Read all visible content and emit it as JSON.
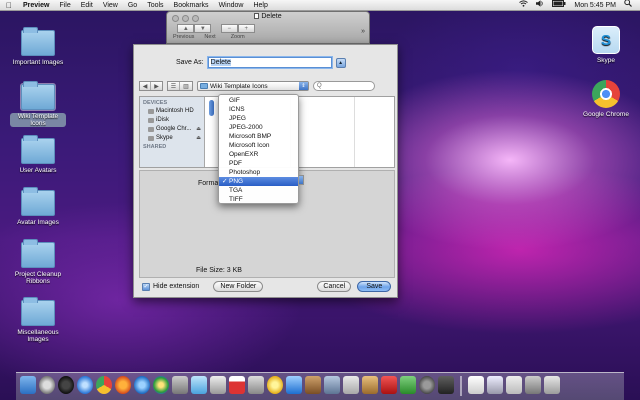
{
  "menubar": {
    "apple_glyph": "",
    "app_name": "Preview",
    "items": [
      "File",
      "Edit",
      "View",
      "Go",
      "Tools",
      "Bookmarks",
      "Window",
      "Help"
    ],
    "clock": "Mon 5:45 PM"
  },
  "desktop": {
    "left_icons": [
      {
        "label": "Important Images"
      },
      {
        "label": "Wiki Template Icons",
        "selected": true
      },
      {
        "label": "User Avatars"
      },
      {
        "label": "Avatar Images"
      },
      {
        "label": "Project Cleanup Ribbons"
      },
      {
        "label": "Miscellaneous Images"
      }
    ],
    "right_icons": [
      {
        "label": "Skype",
        "icon": "skype-icon"
      },
      {
        "label": "Google Chrome",
        "icon": "chrome-icon"
      }
    ]
  },
  "preview_window": {
    "title": "Delete",
    "nav_labels": [
      "Previous",
      "Next"
    ],
    "zoom_label": "Zoom",
    "overflow_glyph": "»"
  },
  "save_sheet": {
    "save_as_label": "Save As:",
    "filename": "Delete",
    "location": "Wiki Template Icons",
    "search_placeholder": "Q",
    "sidebar": {
      "devices_header": "DEVICES",
      "devices": [
        "Macintosh HD",
        "iDisk",
        "Google Chr...",
        "Skype"
      ],
      "shared_header": "SHARED"
    },
    "format_label": "Format:",
    "file_size_label": "File Size:",
    "file_size_value": "3 KB",
    "hide_extension_label": "Hide extension",
    "hide_extension_checked": true,
    "new_folder_label": "New Folder",
    "cancel_label": "Cancel",
    "save_label": "Save"
  },
  "format_menu": {
    "items": [
      "GIF",
      "ICNS",
      "JPEG",
      "JPEG-2000",
      "Microsoft BMP",
      "Microsoft Icon",
      "OpenEXR",
      "PDF",
      "Photoshop",
      "PNG",
      "TGA",
      "TIFF"
    ],
    "selected": "PNG",
    "check_glyph": "✓"
  },
  "colors": {
    "selection_blue": "#2a5ec6",
    "wallpaper_purple": "#3a1a78",
    "wallpaper_magenta": "#e628be"
  }
}
